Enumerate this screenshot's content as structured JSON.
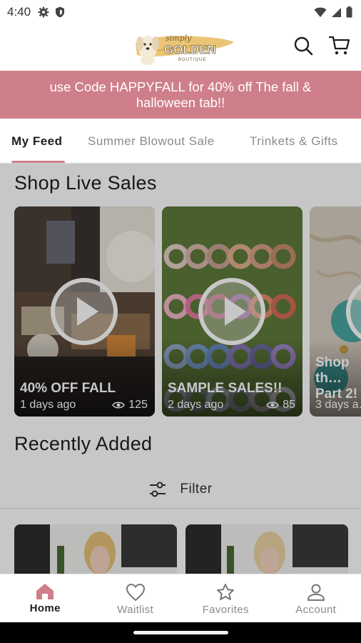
{
  "status_bar": {
    "time": "4:40",
    "icons": [
      "gear-icon",
      "shield-icon",
      "wifi-icon",
      "signal-icon",
      "battery-icon"
    ]
  },
  "header": {
    "logo_script": "simply",
    "logo_main": "GOLDEN",
    "logo_sub": "BOUTIQUE",
    "icons": [
      "search-icon",
      "cart-icon"
    ]
  },
  "promo": {
    "text": "use Code HAPPYFALL for 40% off The fall & halloween tab!!",
    "background": "#cf7f8a"
  },
  "tabs": [
    {
      "label": "My Feed",
      "active": true
    },
    {
      "label": "Summer Blowout Sale",
      "active": false
    },
    {
      "label": "Trinkets & Gifts",
      "active": false
    }
  ],
  "live_sales": {
    "title": "Shop Live Sales",
    "cards": [
      {
        "title": "40% OFF FALL",
        "date": "1 days ago",
        "views": "125"
      },
      {
        "title": "SAMPLE SALES!!",
        "date": "2 days ago",
        "views": "85"
      },
      {
        "title": "Shop th… Part 2!",
        "date": "3 days a…",
        "views": ""
      }
    ]
  },
  "recently_added": {
    "title": "Recently Added",
    "filter_label": "Filter"
  },
  "bottom_nav": [
    {
      "label": "Home",
      "icon": "home-icon",
      "active": true
    },
    {
      "label": "Waitlist",
      "icon": "heart-icon",
      "active": false
    },
    {
      "label": "Favorites",
      "icon": "star-icon",
      "active": false
    },
    {
      "label": "Account",
      "icon": "account-icon",
      "active": false
    }
  ],
  "colors": {
    "accent": "#cf7f8a",
    "text": "#1e1e1e",
    "muted": "#8a8a8a"
  }
}
